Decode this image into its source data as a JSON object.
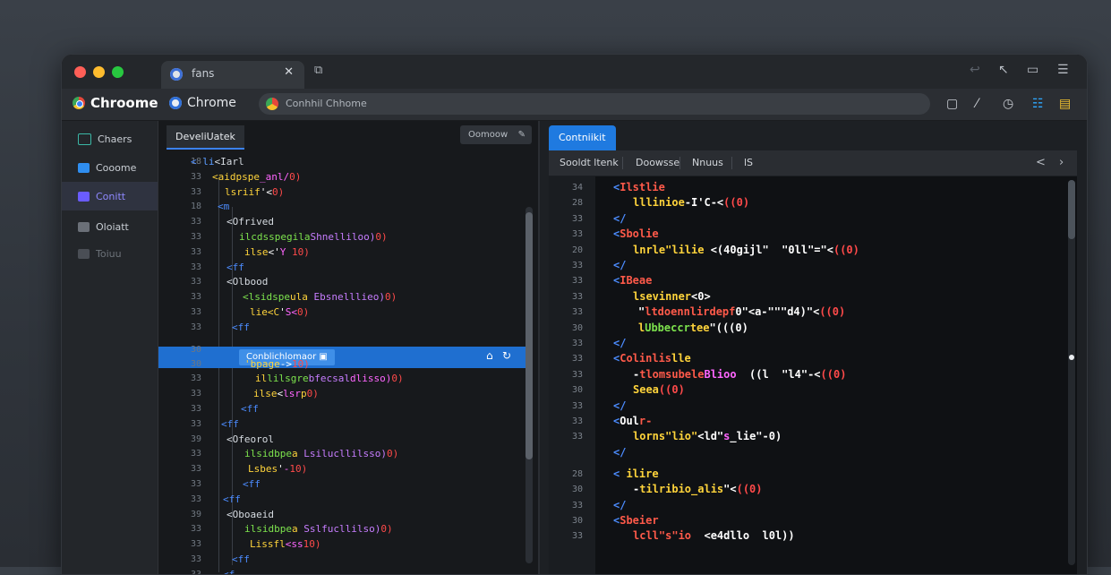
{
  "browser": {
    "traffic_lights": [
      "#ff5f57",
      "#febc2e",
      "#28c840"
    ],
    "tab": {
      "title": "fans",
      "close_icon": "close-icon"
    },
    "brand": "Chroome",
    "brand2": "Chrome",
    "address": "Conhhil Chhome"
  },
  "sidebar": {
    "items": [
      {
        "label": "Chaers",
        "color": "#3bb8a6"
      },
      {
        "label": "Cooome",
        "color": "#2f8ef0"
      },
      {
        "label": "Conitt",
        "color": "#6a5cff"
      },
      {
        "label": "Oloiatt",
        "color": "#6b7078"
      },
      {
        "label": "Toiuu",
        "color": "#4a4e55"
      }
    ]
  },
  "left_panel": {
    "tab_label": "DeveliUatek",
    "pill_label": "Oomoow",
    "highlight_label": "Conblichlomaor",
    "lines": [
      {
        "ln": "18",
        "code": [
          [
            "< ",
            "#4c8cff"
          ],
          [
            "li",
            "#5a9cff"
          ],
          [
            "<Iarl",
            "#d6dbe1"
          ]
        ]
      },
      {
        "ln": "33",
        "code": [
          [
            "<aidpspe",
            "#ffd43b"
          ],
          [
            "_anl/",
            "#ff66ff"
          ],
          [
            "0)",
            "#ff4a4a"
          ]
        ]
      },
      {
        "ln": "33",
        "code": [
          [
            "lsriif",
            "#ffd43b"
          ],
          [
            "'<",
            "#ffffff"
          ],
          [
            "0)",
            "#ff4a4a"
          ]
        ]
      },
      {
        "ln": "18",
        "code": [
          [
            "<m",
            "#4c8cff"
          ]
        ]
      },
      {
        "ln": "33",
        "code": [
          [
            "<Ofrived",
            "#d6dbe1"
          ]
        ]
      },
      {
        "ln": "33",
        "code": [
          [
            "ilcdsspegila",
            "#7de34d"
          ],
          [
            "Shnelliloo)",
            "#c77dff"
          ],
          [
            "0)",
            "#ff4a4a"
          ]
        ]
      },
      {
        "ln": "33",
        "code": [
          [
            "ilse",
            "#ffd43b"
          ],
          [
            "<'",
            "#ffffff"
          ],
          [
            "Y ",
            "#ff66ff"
          ],
          [
            "10)",
            "#ff4a4a"
          ]
        ]
      },
      {
        "ln": "33",
        "code": [
          [
            "<ff",
            "#4c8cff"
          ]
        ]
      },
      {
        "ln": "33",
        "code": [
          [
            "<Olbood",
            "#d6dbe1"
          ]
        ]
      },
      {
        "ln": "33",
        "code": [
          [
            "<lsidspe",
            "#7de34d"
          ],
          [
            "ula ",
            "#ffd43b"
          ],
          [
            "Ebsnelllieo)",
            "#c77dff"
          ],
          [
            "0)",
            "#ff4a4a"
          ]
        ]
      },
      {
        "ln": "33",
        "code": [
          [
            "lie<C",
            "#ffd43b"
          ],
          [
            "'",
            "#ffffff"
          ],
          [
            "S<",
            "#ff66ff"
          ],
          [
            "0)",
            "#ff4a4a"
          ]
        ]
      },
      {
        "ln": "33",
        "code": [
          [
            "<ff",
            "#4c8cff"
          ]
        ]
      },
      {
        "ln": "30",
        "code": []
      },
      {
        "ln": "30",
        "code": [
          [
            "'bpage",
            "#ffd43b"
          ],
          [
            "->",
            "#ffffff"
          ],
          [
            "10)",
            "#ff4a4a"
          ]
        ]
      },
      {
        "ln": "33",
        "code": [
          [
            "il",
            "#ffd43b"
          ],
          [
            "lilsgre",
            "#7de34d"
          ],
          [
            "bfecsal",
            "#c77dff"
          ],
          [
            "dlisso)",
            "#ff66ff"
          ],
          [
            "0)",
            "#ff4a4a"
          ]
        ]
      },
      {
        "ln": "33",
        "code": [
          [
            "ilse",
            "#ffd43b"
          ],
          [
            "<",
            "#ffffff"
          ],
          [
            "lsr",
            "#ff66ff"
          ],
          [
            "p",
            "#ffd43b"
          ],
          [
            "0)",
            "#ff4a4a"
          ]
        ]
      },
      {
        "ln": "33",
        "code": [
          [
            "<ff",
            "#4c8cff"
          ]
        ]
      },
      {
        "ln": "33",
        "code": [
          [
            "<ff",
            "#4c8cff"
          ]
        ]
      },
      {
        "ln": "39",
        "code": [
          [
            "<Ofeorol",
            "#d6dbe1"
          ]
        ]
      },
      {
        "ln": "33",
        "code": [
          [
            "ilsidbpe",
            "#7de34d"
          ],
          [
            "a ",
            "#ffd43b"
          ],
          [
            "Lsilucllilsso)",
            "#c77dff"
          ],
          [
            "0)",
            "#ff4a4a"
          ]
        ]
      },
      {
        "ln": "33",
        "code": [
          [
            "Lsbes",
            "#ffd43b"
          ],
          [
            "'",
            "#ffffff"
          ],
          [
            "-",
            "#ff66ff"
          ],
          [
            "10)",
            "#ff4a4a"
          ]
        ]
      },
      {
        "ln": "33",
        "code": [
          [
            "<ff",
            "#4c8cff"
          ]
        ]
      },
      {
        "ln": "33",
        "code": [
          [
            "<ff",
            "#4c8cff"
          ]
        ]
      },
      {
        "ln": "39",
        "code": [
          [
            "<Oboaeid",
            "#d6dbe1"
          ]
        ]
      },
      {
        "ln": "33",
        "code": [
          [
            "ilsidbpe",
            "#7de34d"
          ],
          [
            "a ",
            "#ffd43b"
          ],
          [
            "Sslfucllilso)",
            "#c77dff"
          ],
          [
            "0)",
            "#ff4a4a"
          ]
        ]
      },
      {
        "ln": "33",
        "code": [
          [
            "Lissfl",
            "#ffd43b"
          ],
          [
            "<ss",
            "#ff66ff"
          ],
          [
            "10)",
            "#ff4a4a"
          ]
        ]
      },
      {
        "ln": "33",
        "code": [
          [
            "<ff",
            "#4c8cff"
          ]
        ]
      },
      {
        "ln": "33",
        "code": [
          [
            "<f",
            "#4c8cff"
          ]
        ]
      }
    ]
  },
  "right_panel": {
    "tab_label": "Contniikit",
    "subtabs": [
      "Sooldt ltenk",
      "Doowsse",
      "Nnuus",
      "lS"
    ],
    "lines": [
      {
        "ln": "34",
        "code": [
          [
            "<",
            "#4c8cff"
          ],
          [
            "Ilstlie",
            "#ff5a4a"
          ]
        ]
      },
      {
        "ln": "28",
        "code": [
          [
            "lllinioe",
            "#ffd43b"
          ],
          [
            "-I'C-<",
            "#ffffff"
          ],
          [
            "((0)",
            "#ff4a4a"
          ]
        ]
      },
      {
        "ln": "33",
        "code": [
          [
            "<",
            "#4c8cff"
          ],
          [
            "/",
            "#4c8cff"
          ]
        ]
      },
      {
        "ln": "33",
        "code": [
          [
            "<",
            "#4c8cff"
          ],
          [
            "Sbolie",
            "#ff5a4a"
          ]
        ]
      },
      {
        "ln": "20",
        "code": [
          [
            "lnrle\"lilie",
            "#ffd43b"
          ],
          [
            " <(40gijl\"  \"0ll\"=\"<",
            "#ffffff"
          ],
          [
            "((0)",
            "#ff4a4a"
          ]
        ]
      },
      {
        "ln": "33",
        "code": [
          [
            "<",
            "#4c8cff"
          ],
          [
            "/",
            "#4c8cff"
          ]
        ]
      },
      {
        "ln": "33",
        "code": [
          [
            "<",
            "#4c8cff"
          ],
          [
            "IBeae",
            "#ff5a4a"
          ]
        ]
      },
      {
        "ln": "33",
        "code": [
          [
            "lsevinner",
            "#ffd43b"
          ],
          [
            "<0>",
            "#ffffff"
          ]
        ]
      },
      {
        "ln": "33",
        "code": [
          [
            "\"",
            "#ffffff"
          ],
          [
            "ltdoennlirdepf",
            "#ff5a4a"
          ],
          [
            "0\"<a-\"\"\"d4)\"<",
            "#ffffff"
          ],
          [
            "((0)",
            "#ff4a4a"
          ]
        ]
      },
      {
        "ln": "30",
        "code": [
          [
            "l",
            "#ffd43b"
          ],
          [
            "Ubbeccr",
            "#7de34d"
          ],
          [
            "tee",
            "#ffd43b"
          ],
          [
            "\"(((0)",
            "#ffffff"
          ]
        ]
      },
      {
        "ln": "33",
        "code": [
          [
            "<",
            "#4c8cff"
          ],
          [
            "/",
            "#4c8cff"
          ]
        ]
      },
      {
        "ln": "33",
        "code": [
          [
            "<",
            "#4c8cff"
          ],
          [
            "Colinlis",
            "#ff5a4a"
          ],
          [
            "lle",
            "#ffd43b"
          ]
        ]
      },
      {
        "ln": "33",
        "code": [
          [
            "-",
            "#ffffff"
          ],
          [
            "tlomsubele",
            "#ff5a4a"
          ],
          [
            "Blioo",
            "#ff66ff"
          ],
          [
            "  ((l  \"l4\"-<",
            "#ffffff"
          ],
          [
            "((0)",
            "#ff4a4a"
          ]
        ]
      },
      {
        "ln": "30",
        "code": [
          [
            "Seea",
            "#ffd43b"
          ],
          [
            "((0)",
            "#ff4a4a"
          ]
        ]
      },
      {
        "ln": "33",
        "code": [
          [
            "<",
            "#4c8cff"
          ],
          [
            "/",
            "#4c8cff"
          ]
        ]
      },
      {
        "ln": "33",
        "code": [
          [
            "<",
            "#4c8cff"
          ],
          [
            "Oul",
            "#ffffff"
          ],
          [
            "r-",
            "#ff5a4a"
          ]
        ]
      },
      {
        "ln": "33",
        "code": [
          [
            "lorns\"lio\"",
            "#ffd43b"
          ],
          [
            "<ld\"",
            "#ffffff"
          ],
          [
            "s",
            "#ff66ff"
          ],
          [
            "_lie\"-0)",
            "#ffffff"
          ]
        ]
      },
      {
        "ln": "",
        "code": [
          [
            "<",
            "#4c8cff"
          ],
          [
            "/",
            "#4c8cff"
          ]
        ]
      },
      {
        "ln": "",
        "code": []
      },
      {
        "ln": "28",
        "code": [
          [
            "<",
            "#4c8cff"
          ],
          [
            " ilire",
            "#ffd43b"
          ]
        ]
      },
      {
        "ln": "30",
        "code": [
          [
            "-",
            "#ffffff"
          ],
          [
            "tilribio_alis",
            "#ffd43b"
          ],
          [
            "\"<",
            "#ffffff"
          ],
          [
            "((0)",
            "#ff4a4a"
          ]
        ]
      },
      {
        "ln": "33",
        "code": [
          [
            "<",
            "#4c8cff"
          ],
          [
            "/",
            "#4c8cff"
          ]
        ]
      },
      {
        "ln": "30",
        "code": [
          [
            "<",
            "#4c8cff"
          ],
          [
            "Sbeier",
            "#ff5a4a"
          ]
        ]
      },
      {
        "ln": "33",
        "code": [
          [
            "lcll\"s\"io",
            "#ff5a4a"
          ],
          [
            "  <e4dllo  l0l)",
            "#ffffff"
          ],
          [
            ")",
            "#ffffff"
          ]
        ]
      }
    ]
  }
}
